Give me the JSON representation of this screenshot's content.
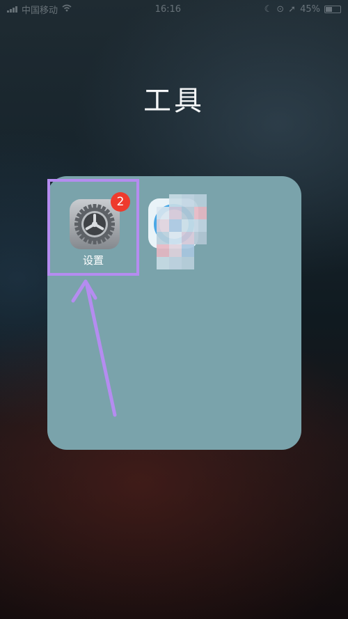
{
  "status_bar": {
    "carrier": "中国移动",
    "time": "16:16",
    "battery": "45%",
    "battery_level": 0.45
  },
  "folder": {
    "title": "工具",
    "apps": [
      {
        "label": "设置",
        "icon": "settings-gear-icon",
        "badge": "2"
      },
      {
        "label": "",
        "icon": "blurred-app-icon"
      }
    ]
  },
  "colors": {
    "folder_bg": "#7aa3ab",
    "highlight": "#b58cf0",
    "badge": "#ee3b2d"
  }
}
